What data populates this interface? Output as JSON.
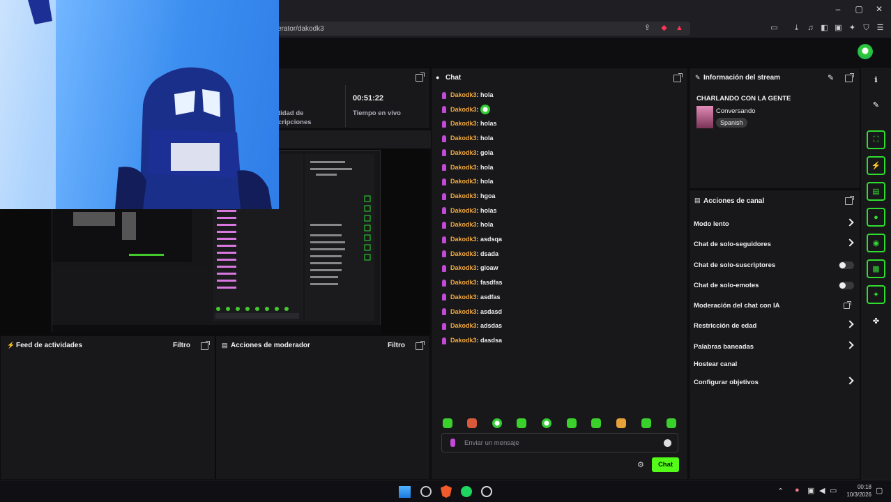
{
  "browser": {
    "url": "erator/dakodk3",
    "window_controls": [
      "–",
      "▢",
      "✕"
    ]
  },
  "stats": {
    "timer": "00:51:22",
    "timer_label": "Tiempo en vivo",
    "subs_label_line1": "tidad de",
    "subs_label_line2": "cripciones"
  },
  "activity_feed": {
    "title": "Feed de actividades",
    "filter": "Filtro"
  },
  "mod_actions": {
    "title": "Acciones de moderador",
    "filter": "Filtro"
  },
  "chat": {
    "title": "Chat",
    "messages": [
      {
        "user": "Dakodk3",
        "text": "hola"
      },
      {
        "user": "Dakodk3",
        "text": ""
      },
      {
        "user": "Dakodk3",
        "text": "holas"
      },
      {
        "user": "Dakodk3",
        "text": "hola"
      },
      {
        "user": "Dakodk3",
        "text": "gola"
      },
      {
        "user": "Dakodk3",
        "text": "hola"
      },
      {
        "user": "Dakodk3",
        "text": "hola"
      },
      {
        "user": "Dakodk3",
        "text": "hgoa"
      },
      {
        "user": "Dakodk3",
        "text": "holas"
      },
      {
        "user": "Dakodk3",
        "text": "hola"
      },
      {
        "user": "Dakodk3",
        "text": "asdsqa"
      },
      {
        "user": "Dakodk3",
        "text": "dsada"
      },
      {
        "user": "Dakodk3",
        "text": "gioaw"
      },
      {
        "user": "Dakodk3",
        "text": "fasdfas"
      },
      {
        "user": "Dakodk3",
        "text": "asdfas"
      },
      {
        "user": "Dakodk3",
        "text": "asdasd"
      },
      {
        "user": "Dakodk3",
        "text": "adsdas"
      },
      {
        "user": "Dakodk3",
        "text": "dasdsa"
      }
    ],
    "input_placeholder": "Enviar un mensaje",
    "send_button": "Chat"
  },
  "stream_info": {
    "title": "Información del stream",
    "stream_title": "CHARLANDO CON LA GENTE",
    "category": "Conversando",
    "tag": "Spanish"
  },
  "channel_actions": {
    "title": "Acciones de canal",
    "items": [
      {
        "label": "Modo lento",
        "control": "chevron"
      },
      {
        "label": "Chat de solo-seguidores",
        "control": "chevron"
      },
      {
        "label": "Chat de solo-suscriptores",
        "control": "toggle"
      },
      {
        "label": "Chat de solo-emotes",
        "control": "toggle"
      },
      {
        "label": "Moderación del chat con IA",
        "control": "popout"
      },
      {
        "label": "Restricción de edad",
        "control": "chevron"
      },
      {
        "label": "Palabras baneadas",
        "control": "chevron"
      },
      {
        "label": "Hostear canal",
        "control": "none"
      },
      {
        "label": "Configurar objetivos",
        "control": "chevron"
      }
    ]
  },
  "taskbar": {
    "time": "00:18",
    "date": "10/3/2026"
  },
  "colors": {
    "accent": "#53fc18",
    "username": "#f2a93b",
    "panel": "#18181b",
    "background": "#0e0e10"
  }
}
